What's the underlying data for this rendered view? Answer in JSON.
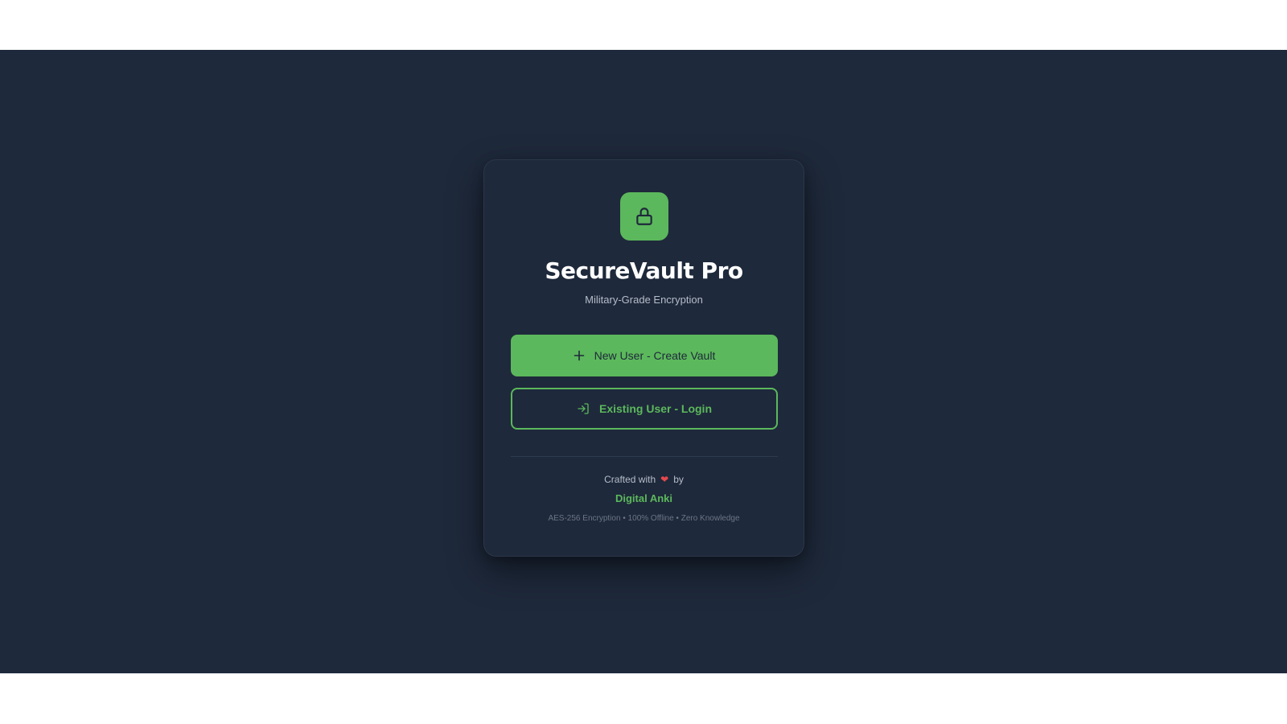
{
  "app": {
    "title": "SecureVault Pro",
    "subtitle": "Military-Grade Encryption",
    "logo_icon": "lock-icon"
  },
  "actions": {
    "create": {
      "label": "New User - Create Vault",
      "icon": "plus-icon"
    },
    "login": {
      "label": "Existing User - Login",
      "icon": "login-icon"
    }
  },
  "footer": {
    "crafted_prefix": "Crafted with",
    "heart_icon": "heart-icon",
    "crafted_suffix": "by",
    "author": "Digital Anki",
    "features": "AES-256 Encryption • 100% Offline • Zero Knowledge"
  },
  "colors": {
    "background": "#1e293b",
    "accent": "#5cb85c",
    "heart": "#e5484d"
  }
}
